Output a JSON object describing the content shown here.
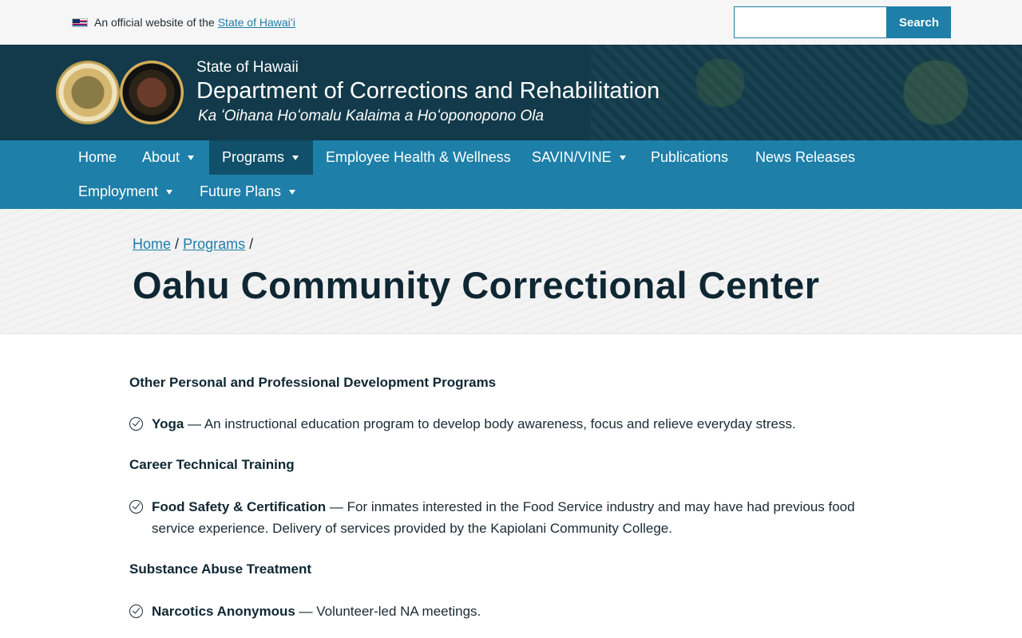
{
  "official_bar": {
    "text": "An official website of the",
    "link": "State of Hawaiʻi",
    "search_placeholder": "",
    "search_button": "Search"
  },
  "header": {
    "state": "State of Hawaii",
    "department": "Department of Corrections and Rehabilitation",
    "hawaiian_name": "Ka ʻOihana Hoʻomalu Kalaima a Hoʻoponopono Ola"
  },
  "nav": {
    "items": [
      {
        "label": "Home",
        "dropdown": false,
        "active": false
      },
      {
        "label": "About",
        "dropdown": true,
        "active": false
      },
      {
        "label": "Programs",
        "dropdown": true,
        "active": true
      },
      {
        "label": "Employee Health & Wellness",
        "dropdown": false,
        "active": false
      },
      {
        "label": "SAVIN/VINE",
        "dropdown": true,
        "active": false
      },
      {
        "label": "Publications",
        "dropdown": false,
        "active": false
      },
      {
        "label": "News Releases",
        "dropdown": false,
        "active": false
      },
      {
        "label": "Employment",
        "dropdown": true,
        "active": false
      },
      {
        "label": "Future Plans",
        "dropdown": true,
        "active": false
      }
    ]
  },
  "breadcrumb": {
    "home": "Home",
    "programs": "Programs",
    "sep": "/"
  },
  "page_title": "Oahu Community Correctional Center",
  "content": {
    "sections": [
      {
        "heading": "Other Personal and Professional Development Programs",
        "items": [
          {
            "name": "Yoga",
            "description": " — An instructional education program to develop body awareness, focus and relieve everyday stress."
          }
        ]
      },
      {
        "heading": "Career Technical Training",
        "items": [
          {
            "name": "Food Safety & Certification",
            "description": " — For inmates interested in the Food Service industry and may have had previous food service experience. Delivery of services provided by the Kapiolani Community College."
          }
        ]
      },
      {
        "heading": "Substance Abuse Treatment",
        "items": [
          {
            "name": "Narcotics Anonymous",
            "description": " — Volunteer-led NA meetings."
          }
        ]
      }
    ]
  },
  "colors": {
    "nav_bg": "#1e7fa8",
    "nav_active": "#11506a",
    "header_bg": "#123a4a",
    "title": "#0f2733"
  }
}
